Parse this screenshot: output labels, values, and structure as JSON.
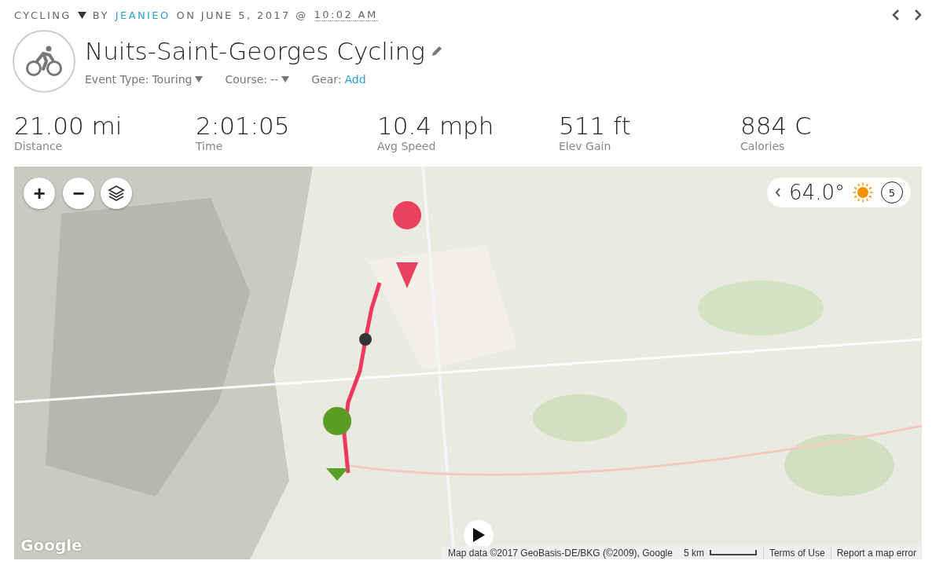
{
  "header": {
    "activity_type": "CYCLING",
    "by": "BY",
    "author": "JEANIEO",
    "on": "ON JUNE 5, 2017 @",
    "time": "10:02 AM"
  },
  "title": "Nuits-Saint-Georges Cycling",
  "meta": [
    {
      "kind": "dropdown",
      "label": "Event Type:",
      "value": "Touring"
    },
    {
      "kind": "dropdown",
      "label": "Course:",
      "value": "--"
    },
    {
      "kind": "link",
      "label": "Gear:",
      "value": "Add"
    }
  ],
  "stats": [
    {
      "value": "21.00 mi",
      "label": "Distance"
    },
    {
      "value": "2:01:05",
      "label": "Time"
    },
    {
      "value": "10.4 mph",
      "label": "Avg Speed"
    },
    {
      "value": "511 ft",
      "label": "Elev Gain"
    },
    {
      "value": "884 C",
      "label": "Calories"
    }
  ],
  "map": {
    "kind": "picture",
    "zoom_in": "+",
    "zoom_out": "−",
    "weather": {
      "temperature": "64.0°",
      "wind": "5"
    },
    "logo": "Google",
    "attribution": "Map data ©2017 GeoBasis-DE/BKG (©2009), Google",
    "scale": "5 km",
    "links": [
      "Terms of Use",
      "Report a map error"
    ]
  }
}
